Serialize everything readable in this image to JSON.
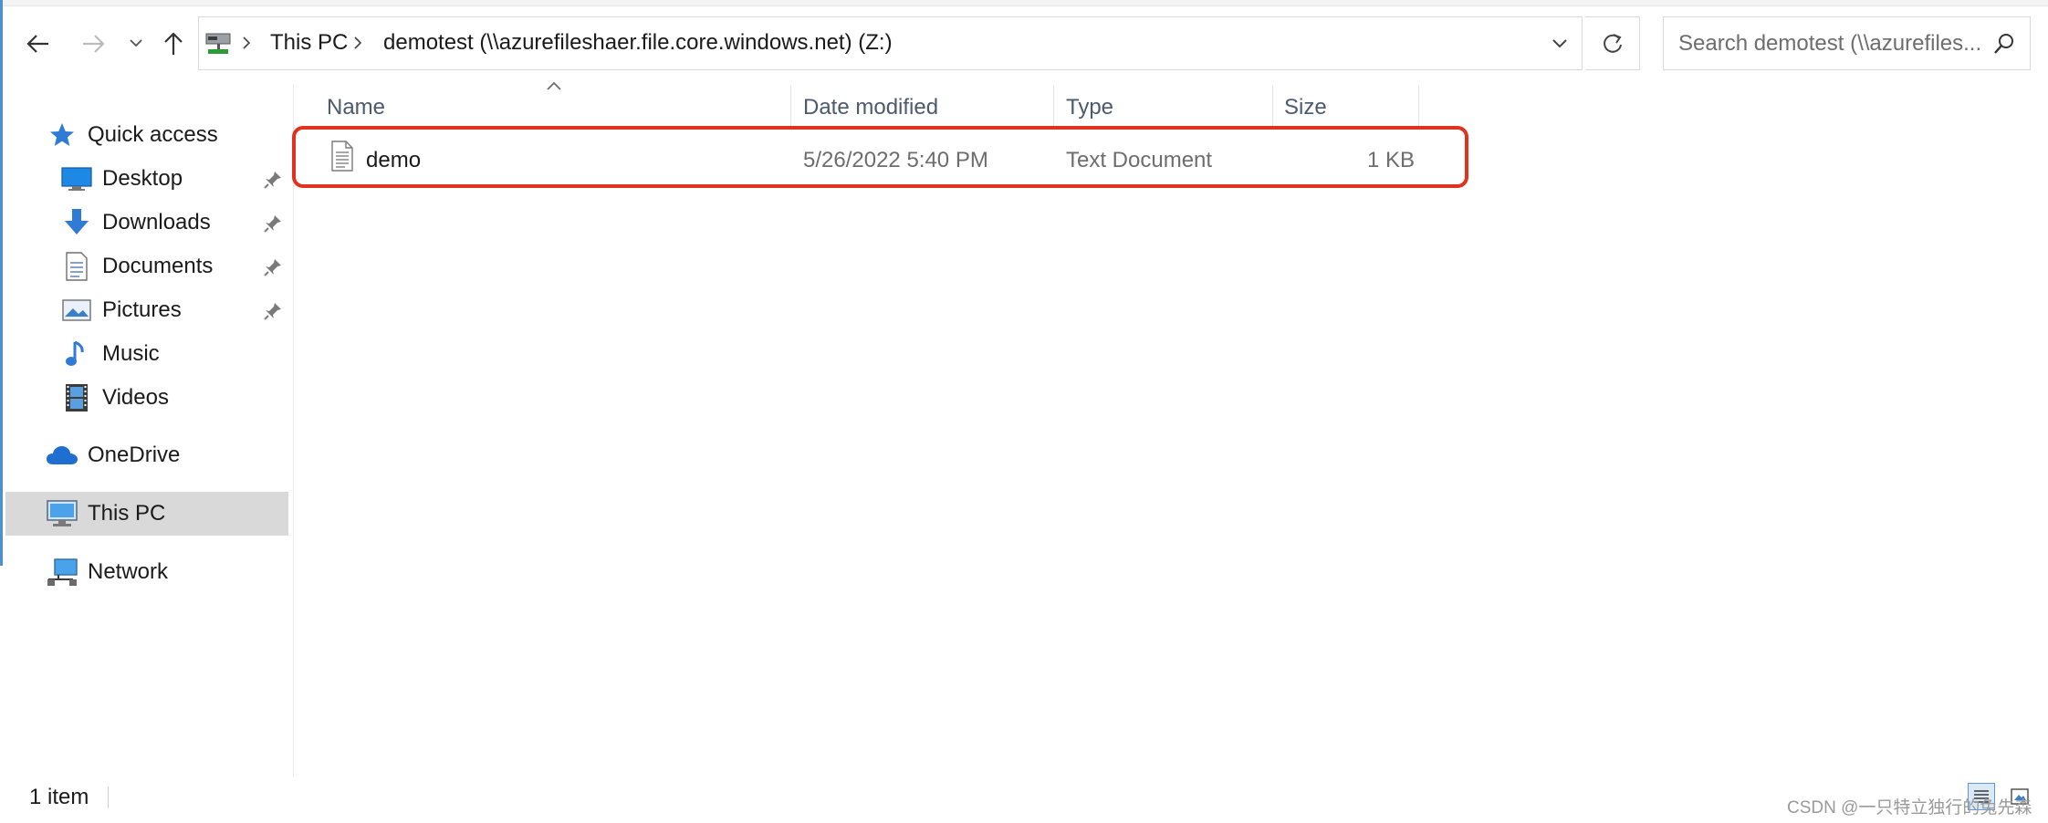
{
  "address_bar": {
    "breadcrumbs": [
      "This PC",
      "demotest (\\\\azurefileshaer.file.core.windows.net) (Z:)"
    ],
    "search_placeholder": "Search demotest (\\\\azurefiles..."
  },
  "nav_pane": {
    "quick_access": "Quick access",
    "pinned": [
      {
        "label": "Desktop",
        "icon": "desktop-icon",
        "pinned": true
      },
      {
        "label": "Downloads",
        "icon": "downloads-icon",
        "pinned": true
      },
      {
        "label": "Documents",
        "icon": "documents-icon",
        "pinned": true
      },
      {
        "label": "Pictures",
        "icon": "pictures-icon",
        "pinned": true
      },
      {
        "label": "Music",
        "icon": "music-icon",
        "pinned": false
      },
      {
        "label": "Videos",
        "icon": "videos-icon",
        "pinned": false
      }
    ],
    "onedrive": "OneDrive",
    "this_pc": "This PC",
    "network": "Network",
    "selected": "This PC"
  },
  "file_list": {
    "columns": [
      "Name",
      "Date modified",
      "Type",
      "Size"
    ],
    "sort_column": "Name",
    "rows": [
      {
        "name": "demo",
        "date_modified": "5/26/2022 5:40 PM",
        "type": "Text Document",
        "size": "1 KB",
        "highlighted": true
      }
    ]
  },
  "status_bar": {
    "item_count": "1 item",
    "watermark": "CSDN @一只特立独行的兔先森"
  },
  "colors": {
    "highlight_border": "#e0321e",
    "selected_bg": "#d9d9d9",
    "column_header_text": "#4c5a6e",
    "accent": "#4a90d9"
  }
}
